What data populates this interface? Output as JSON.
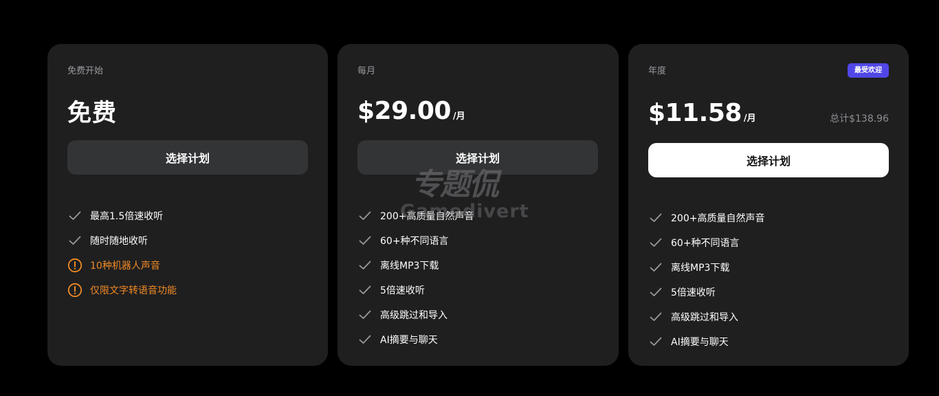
{
  "colors": {
    "background": "#000000",
    "card": "#1f1f20",
    "button_dark": "#333436",
    "button_light": "#ffffff",
    "badge": "#5147e6",
    "warning": "#f08a24",
    "check": "#9a9a9e"
  },
  "plans": [
    {
      "name": "免费开始",
      "price": "免费",
      "button_label": "选择计划",
      "features": [
        {
          "text": "最高1.5倍速收听",
          "icon": "check-icon"
        },
        {
          "text": "随时随地收听",
          "icon": "check-icon"
        },
        {
          "text": "10种机器人声音",
          "icon": "warning-icon"
        },
        {
          "text": "仅限文字转语音功能",
          "icon": "warning-icon"
        }
      ]
    },
    {
      "name": "每月",
      "price": "$29.00",
      "unit": "/月",
      "button_label": "选择计划",
      "features": [
        {
          "text": "200+高质量自然声音",
          "icon": "check-icon"
        },
        {
          "text": "60+种不同语言",
          "icon": "check-icon"
        },
        {
          "text": "离线MP3下载",
          "icon": "check-icon"
        },
        {
          "text": "5倍速收听",
          "icon": "check-icon"
        },
        {
          "text": "高级跳过和导入",
          "icon": "check-icon"
        },
        {
          "text": "AI摘要与聊天",
          "icon": "check-icon"
        }
      ]
    },
    {
      "name": "年度",
      "badge": "最受欢迎",
      "price": "$11.58",
      "unit": "/月",
      "total": "总计$138.96",
      "button_label": "选择计划",
      "features": [
        {
          "text": "200+高质量自然声音",
          "icon": "check-icon"
        },
        {
          "text": "60+种不同语言",
          "icon": "check-icon"
        },
        {
          "text": "离线MP3下载",
          "icon": "check-icon"
        },
        {
          "text": "5倍速收听",
          "icon": "check-icon"
        },
        {
          "text": "高级跳过和导入",
          "icon": "check-icon"
        },
        {
          "text": "AI摘要与聊天",
          "icon": "check-icon"
        }
      ]
    }
  ],
  "watermark": {
    "logo_text": "专题侃",
    "brand_text": "Gamedivert"
  }
}
